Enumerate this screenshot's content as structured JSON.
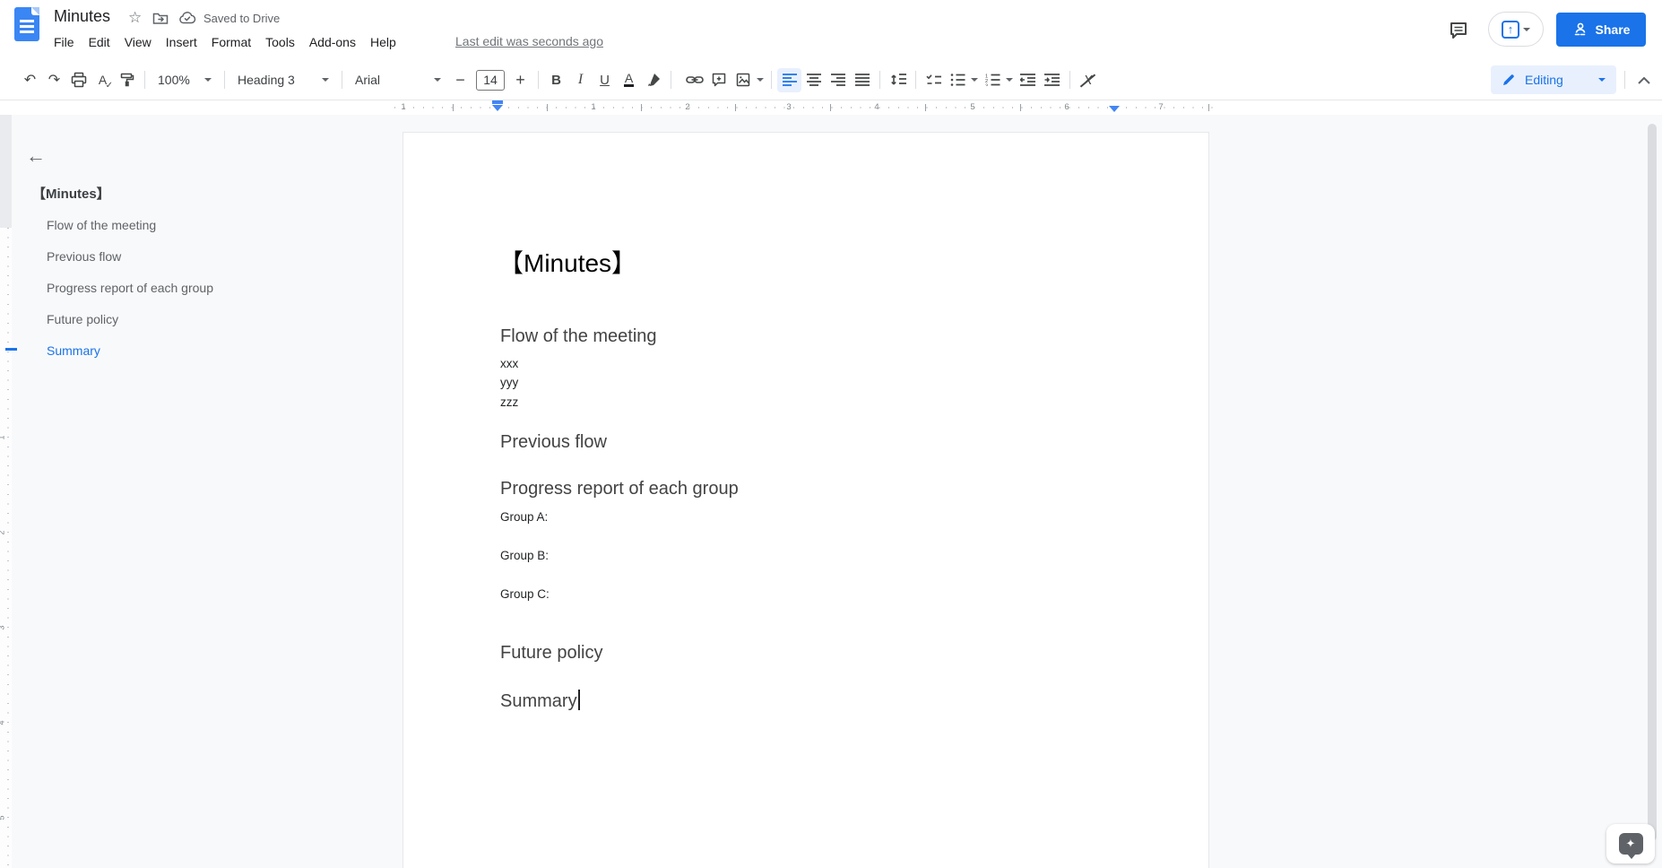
{
  "header": {
    "doc_title": "Minutes",
    "saved_status": "Saved to Drive",
    "last_edit": "Last edit was seconds ago",
    "menus": [
      "File",
      "Edit",
      "View",
      "Insert",
      "Format",
      "Tools",
      "Add-ons",
      "Help"
    ],
    "share_label": "Share",
    "mode_label": "Editing"
  },
  "toolbar": {
    "zoom_value": "100%",
    "paragraph_style": "Heading 3",
    "font_name": "Arial",
    "font_size": "14",
    "glyphs": {
      "undo": "↶",
      "redo": "↷",
      "star": "☆",
      "bold": "B",
      "italic": "I",
      "underline": "U",
      "text_color": "A",
      "spellcheck": "A",
      "check": "✓",
      "minus": "−",
      "plus": "+",
      "clear_formatting": "X",
      "upload_arrow": "↑",
      "back": "←",
      "explore": "✦"
    }
  },
  "outline": {
    "title": "【Minutes】",
    "items": [
      {
        "label": "Flow of the meeting",
        "active": false
      },
      {
        "label": "Previous flow",
        "active": false
      },
      {
        "label": "Progress report of each group",
        "active": false
      },
      {
        "label": "Future policy",
        "active": false
      },
      {
        "label": "Summary",
        "active": true
      }
    ]
  },
  "ruler": {
    "h_numbers": [
      "1",
      "1",
      "2",
      "3",
      "4",
      "5",
      "6",
      "7"
    ],
    "v_numbers": [
      "1",
      "2",
      "3",
      "4",
      "5",
      "6"
    ]
  },
  "document": {
    "blocks": [
      {
        "type": "title",
        "text": "【Minutes】"
      },
      {
        "type": "h3",
        "text": "Flow of the meeting"
      },
      {
        "type": "body",
        "text": "xxx"
      },
      {
        "type": "body",
        "text": "yyy"
      },
      {
        "type": "body",
        "text": "zzz"
      },
      {
        "type": "h3",
        "text": "Previous flow"
      },
      {
        "type": "h3",
        "text": "Progress report of each group"
      },
      {
        "type": "body",
        "text": "Group A:"
      },
      {
        "type": "body",
        "text": "Group B:"
      },
      {
        "type": "body",
        "text": "Group C:"
      },
      {
        "type": "h3",
        "text": "Future policy"
      },
      {
        "type": "h3",
        "text": "Summary",
        "cursor": true
      }
    ]
  },
  "colors": {
    "accent": "#1a73e8",
    "active_background": "#e8f0fe",
    "canvas_background": "#f8f9fa",
    "icon_gray": "#444746"
  }
}
